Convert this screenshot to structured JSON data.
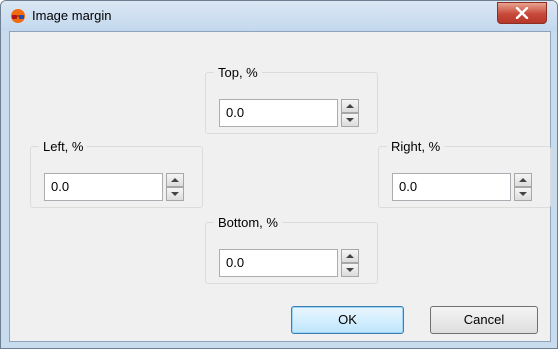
{
  "window": {
    "title": "Image margin"
  },
  "fields": {
    "top": {
      "label": "Top, %",
      "value": "0.0"
    },
    "left": {
      "label": "Left, %",
      "value": "0.0"
    },
    "right": {
      "label": "Right, %",
      "value": "0.0"
    },
    "bottom": {
      "label": "Bottom, %",
      "value": "0.0"
    }
  },
  "buttons": {
    "ok": "OK",
    "cancel": "Cancel"
  },
  "icons": {
    "app": "glasses-icon",
    "close": "close-icon",
    "spin_up": "arrow-up-icon",
    "spin_down": "arrow-down-icon"
  }
}
